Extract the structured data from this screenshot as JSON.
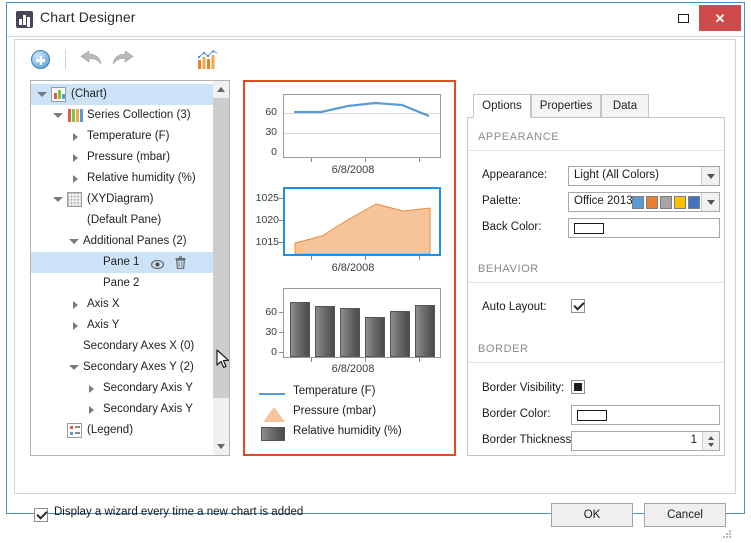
{
  "window": {
    "title": "Chart Designer",
    "icon": "chart-app-icon",
    "restore_label": "Restore",
    "close_label": "✕"
  },
  "toolbar": {
    "add_label": "add-item",
    "undo_label": "undo",
    "redo_label": "redo",
    "chart_wizard_label": "chart-wizard"
  },
  "tree": {
    "items": [
      {
        "label": "(Chart)",
        "indent": 20,
        "expander": "open",
        "icon": "chart-icon",
        "selected": true
      },
      {
        "label": "Series Collection (3)",
        "indent": 36,
        "expander": "open",
        "icon": "series-icon",
        "selected": false
      },
      {
        "label": "Temperature (F)",
        "indent": 56,
        "expander": "closed",
        "icon": "none",
        "selected": false
      },
      {
        "label": "Pressure (mbar)",
        "indent": 56,
        "expander": "closed",
        "icon": "none",
        "selected": false
      },
      {
        "label": "Relative humidity (%)",
        "indent": 56,
        "expander": "closed",
        "icon": "none",
        "selected": false
      },
      {
        "label": "(XYDiagram)",
        "indent": 36,
        "expander": "open",
        "icon": "diagram-icon",
        "selected": false
      },
      {
        "label": "(Default Pane)",
        "indent": 56,
        "expander": "none",
        "icon": "none",
        "selected": false
      },
      {
        "label": "Additional Panes (2)",
        "indent": 52,
        "expander": "open",
        "icon": "none",
        "selected": false
      },
      {
        "label": "Pane 1",
        "indent": 72,
        "expander": "none",
        "icon": "none",
        "selected": true,
        "actions": [
          "eye-icon",
          "trash-icon"
        ]
      },
      {
        "label": "Pane 2",
        "indent": 72,
        "expander": "none",
        "icon": "none",
        "selected": false
      },
      {
        "label": "Axis X",
        "indent": 56,
        "expander": "closed",
        "icon": "none",
        "selected": false
      },
      {
        "label": "Axis Y",
        "indent": 56,
        "expander": "closed",
        "icon": "none",
        "selected": false
      },
      {
        "label": "Secondary Axes X (0)",
        "indent": 52,
        "expander": "none",
        "icon": "none",
        "selected": false
      },
      {
        "label": "Secondary Axes Y (2)",
        "indent": 52,
        "expander": "open",
        "icon": "none",
        "selected": false
      },
      {
        "label": "Secondary Axis Y",
        "indent": 72,
        "expander": "closed",
        "icon": "none",
        "selected": false
      },
      {
        "label": "Secondary Axis Y",
        "indent": 72,
        "expander": "closed",
        "icon": "none",
        "selected": false
      },
      {
        "label": "(Legend)",
        "indent": 36,
        "expander": "none",
        "icon": "legend-icon",
        "selected": false
      }
    ],
    "scroll_up": "scroll-up",
    "scroll_down": "scroll-down"
  },
  "chart_data": [
    {
      "type": "line",
      "title": "",
      "pane": "Default Pane",
      "series_name": "Temperature (F)",
      "color": "#5b9bd5",
      "xlabel": "6/8/2008",
      "ylabel": "",
      "ytick_labels": [
        "60",
        "30",
        "0"
      ],
      "ylim": [
        0,
        75
      ],
      "yticks": [
        0,
        30,
        60
      ],
      "x": [
        1,
        2,
        3,
        4,
        5,
        6
      ],
      "values": [
        60,
        60,
        67,
        70,
        68,
        56
      ],
      "grid": true,
      "selected": false
    },
    {
      "type": "area",
      "title": "",
      "pane": "Pane 1",
      "series_name": "Pressure (mbar)",
      "color": "#f6c49a",
      "xlabel": "6/8/2008",
      "ylabel": "",
      "ytick_labels": [
        "1025",
        "1020",
        "1015"
      ],
      "ylim": [
        1013,
        1026
      ],
      "yticks": [
        1015,
        1020,
        1025
      ],
      "x": [
        1,
        2,
        3,
        4,
        5,
        6
      ],
      "values": [
        1015.0,
        1016.8,
        1020.4,
        1023.2,
        1021.8,
        1022.2
      ],
      "grid": false,
      "selected": true
    },
    {
      "type": "bar",
      "title": "",
      "pane": "Pane 2",
      "series_name": "Relative humidity (%)",
      "color": "#6f6f6f",
      "xlabel": "6/8/2008",
      "ylabel": "",
      "ytick_labels": [
        "60",
        "30",
        "0"
      ],
      "ylim": [
        0,
        80
      ],
      "yticks": [
        0,
        30,
        60
      ],
      "categories": [
        "1",
        "2",
        "3",
        "4",
        "5",
        "6"
      ],
      "values": [
        72,
        68,
        66,
        54,
        62,
        69
      ],
      "grid": false,
      "selected": false
    }
  ],
  "legend": {
    "entries": [
      {
        "label": "Temperature (F)",
        "marker": "line",
        "color": "#5b9bd5"
      },
      {
        "label": "Pressure (mbar)",
        "marker": "triangle",
        "color": "#f6c49a"
      },
      {
        "label": "Relative humidity (%)",
        "marker": "square",
        "color": "#6f6f6f"
      }
    ]
  },
  "options": {
    "tabs": [
      {
        "label": "Options",
        "active": true
      },
      {
        "label": "Properties",
        "active": false
      },
      {
        "label": "Data",
        "active": false
      }
    ],
    "sections": [
      {
        "title": "APPEARANCE"
      },
      {
        "title": "BEHAVIOR"
      },
      {
        "title": "BORDER"
      }
    ],
    "appearance_label": "Appearance:",
    "appearance_value": "Light (All Colors)",
    "palette_label": "Palette:",
    "palette_value": "Office 2013",
    "palette_swatches": [
      "#5b9bd5",
      "#ed7d31",
      "#a5a5a5",
      "#ffc000",
      "#4472c4",
      "#70ad47"
    ],
    "back_color_label": "Back Color:",
    "back_color_value": "#ffffff",
    "auto_layout_label": "Auto Layout:",
    "auto_layout_checked": true,
    "border_visibility_label": "Border Visibility:",
    "border_visibility_state": "filled",
    "border_color_label": "Border Color:",
    "border_color_value": "#ffffff",
    "border_thickness_label": "Border Thickness:",
    "border_thickness_value": "1"
  },
  "footer": {
    "wizard_checkbox_label": "Display a wizard every time a new chart is added",
    "wizard_checked": true,
    "ok_label": "OK",
    "cancel_label": "Cancel"
  }
}
